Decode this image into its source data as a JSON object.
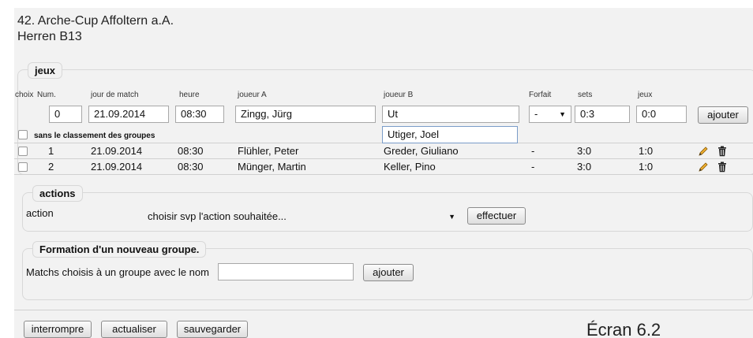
{
  "page": {
    "title": "42. Arche-Cup Affoltern a.A.",
    "subtitle": "Herren B13",
    "caption": "Écran 6.2"
  },
  "games": {
    "legend": "jeux",
    "headers": {
      "choice": "choix",
      "num": "Num.",
      "date": "jour de match",
      "time": "heure",
      "player_a": "joueur A",
      "player_b": "joueur B",
      "forfeit": "Forfait",
      "sets": "sets",
      "games": "jeux"
    },
    "new_row": {
      "num": "0",
      "date": "21.09.2014",
      "time": "08:30",
      "player_a": "Zingg, Jürg",
      "player_b": "Ut",
      "forfeit": "-",
      "sets": "0:3",
      "games": "0:0",
      "add_label": "ajouter"
    },
    "autocomplete_option": "Utiger, Joel",
    "group_label": "sans le classement des groupes",
    "rows": [
      {
        "num": "1",
        "date": "21.09.2014",
        "time": "08:30",
        "player_a": "Flühler, Peter",
        "player_b": "Greder, Giuliano",
        "forfeit": "-",
        "sets": "3:0",
        "games": "1:0"
      },
      {
        "num": "2",
        "date": "21.09.2014",
        "time": "08:30",
        "player_a": "Münger, Martin",
        "player_b": "Keller, Pino",
        "forfeit": "-",
        "sets": "3:0",
        "games": "1:0"
      }
    ]
  },
  "actions": {
    "legend": "actions",
    "label": "action",
    "select_value": "choisir svp l'action souhaitée...",
    "execute_label": "effectuer"
  },
  "group": {
    "legend": "Formation d'un nouveau groupe.",
    "label": "Matchs choisis à un groupe avec le nom",
    "name_value": "",
    "add_label": "ajouter"
  },
  "footer": {
    "abort_label": "interrompre",
    "refresh_label": "actualiser",
    "save_label": "sauvegarder"
  },
  "icons": {
    "edit": "pencil-icon",
    "delete": "trash-icon"
  }
}
